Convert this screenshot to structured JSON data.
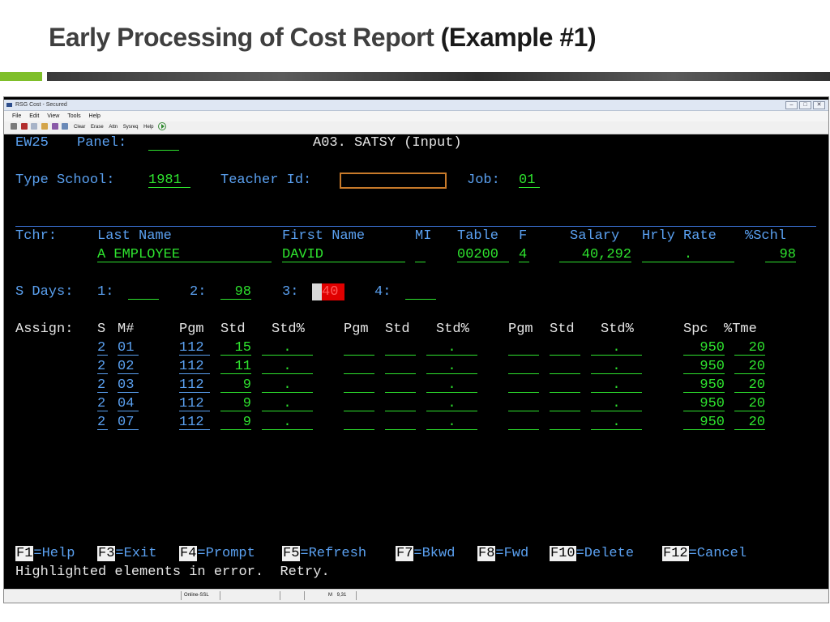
{
  "slide": {
    "title": "Early Processing of Cost Report",
    "title_suffix": "(Example #1)"
  },
  "window": {
    "title": "RSG Cost - Secured",
    "buttons": {
      "minimize": "–",
      "restore": "□",
      "close": "✕"
    }
  },
  "menu": [
    "File",
    "Edit",
    "View",
    "Tools",
    "Help"
  ],
  "toolbar": {
    "labels": [
      "Clear",
      "Erase",
      "Attn",
      "Sysreq",
      "Help"
    ]
  },
  "screen": {
    "panel_code": "EW25",
    "panel_label": "Panel:",
    "panel_value": "",
    "screen_title": "A03. SATSY (Input)",
    "type_school_label": "Type School:",
    "type_school_value": "1981",
    "teacher_id_label": "Teacher Id:",
    "teacher_id_value": "",
    "job_label": "Job:",
    "job_value": "01",
    "tchr_label": "Tchr:",
    "headers": {
      "last_name": "Last Name",
      "first_name": "First Name",
      "mi": "MI",
      "table": "Table",
      "f": "F",
      "salary": "Salary",
      "hrly_rate": "Hrly Rate",
      "pct_schl": "%Schl"
    },
    "employee": {
      "last_name": "A EMPLOYEE",
      "first_name": "DAVID",
      "mi": "",
      "table": "00200",
      "f": "4",
      "salary": "40,292",
      "hrly_rate": ".",
      "pct_schl": "98"
    },
    "sdays": {
      "label": "S Days:",
      "d1_label": "1:",
      "d1_value": "",
      "d2_label": "2:",
      "d2_value": "98",
      "d3_label": "3:",
      "d3_value": "40",
      "d4_label": "4:",
      "d4_value": ""
    },
    "assign": {
      "label": "Assign:",
      "headers": {
        "s": "S",
        "m": "M#",
        "pgm1": "Pgm",
        "std1": "Std",
        "stdpct1": "Std%",
        "pgm2": "Pgm",
        "std2": "Std",
        "stdpct2": "Std%",
        "pgm3": "Pgm",
        "std3": "Std",
        "stdpct3": "Std%",
        "spc": "Spc",
        "tme": "%Tme"
      },
      "rows": [
        {
          "s": "2",
          "m": "01",
          "pgm": "112",
          "std": "15",
          "stdpct": ".",
          "stdpct2": ".",
          "stdpct3": ".",
          "spc": "950",
          "tme": "20"
        },
        {
          "s": "2",
          "m": "02",
          "pgm": "112",
          "std": "11",
          "stdpct": ".",
          "stdpct2": ".",
          "stdpct3": ".",
          "spc": "950",
          "tme": "20"
        },
        {
          "s": "2",
          "m": "03",
          "pgm": "112",
          "std": "9",
          "stdpct": ".",
          "stdpct2": ".",
          "stdpct3": ".",
          "spc": "950",
          "tme": "20"
        },
        {
          "s": "2",
          "m": "04",
          "pgm": "112",
          "std": "9",
          "stdpct": ".",
          "stdpct2": ".",
          "stdpct3": ".",
          "spc": "950",
          "tme": "20"
        },
        {
          "s": "2",
          "m": "07",
          "pgm": "112",
          "std": "9",
          "stdpct": ".",
          "stdpct2": ".",
          "stdpct3": ".",
          "spc": "950",
          "tme": "20"
        }
      ]
    },
    "fkeys": [
      {
        "key": "F1",
        "desc": "=Help"
      },
      {
        "key": "F3",
        "desc": "=Exit"
      },
      {
        "key": "F4",
        "desc": "=Prompt"
      },
      {
        "key": "F5",
        "desc": "=Refresh"
      },
      {
        "key": "F7",
        "desc": "=Bkwd"
      },
      {
        "key": "F8",
        "desc": "=Fwd"
      },
      {
        "key": "F10",
        "desc": "=Delete"
      },
      {
        "key": "F12",
        "desc": "=Cancel"
      }
    ],
    "message": "Highlighted elements in error.  Retry."
  },
  "statusbar": {
    "connection": "Online-SSL",
    "mode": "M",
    "cursor": "9,31"
  },
  "colors": {
    "terminal_bg": "#000000",
    "label_blue": "#5aa0f0",
    "field_green": "#2ee32e",
    "error_red": "#e00000",
    "focus_orange": "#c87a2a"
  }
}
